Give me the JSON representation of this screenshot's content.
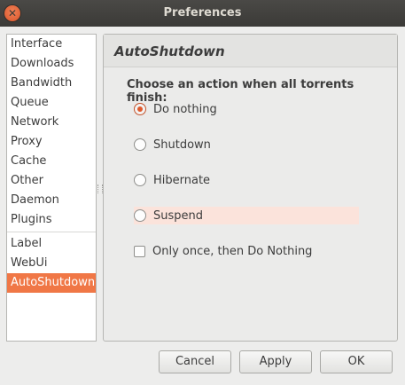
{
  "window": {
    "title": "Preferences",
    "close_glyph": "✕"
  },
  "sidebar": {
    "items": [
      {
        "label": "Interface"
      },
      {
        "label": "Downloads"
      },
      {
        "label": "Bandwidth"
      },
      {
        "label": "Queue"
      },
      {
        "label": "Network"
      },
      {
        "label": "Proxy"
      },
      {
        "label": "Cache"
      },
      {
        "label": "Other"
      },
      {
        "label": "Daemon"
      },
      {
        "label": "Plugins"
      }
    ],
    "plugin_items": [
      {
        "label": "Label"
      },
      {
        "label": "WebUi"
      },
      {
        "label": "AutoShutdown"
      }
    ],
    "selected": "AutoShutdown",
    "accent_color": "#f07746"
  },
  "panel": {
    "title": "AutoShutdown",
    "prompt": "Choose an action when all torrents finish:",
    "options": [
      {
        "label": "Do nothing",
        "checked": true
      },
      {
        "label": "Shutdown",
        "checked": false
      },
      {
        "label": "Hibernate",
        "checked": false
      },
      {
        "label": "Suspend",
        "checked": false
      }
    ],
    "once_checkbox": {
      "label": "Only once, then Do Nothing",
      "checked": false
    }
  },
  "buttons": {
    "cancel": "Cancel",
    "apply": "Apply",
    "ok": "OK"
  }
}
